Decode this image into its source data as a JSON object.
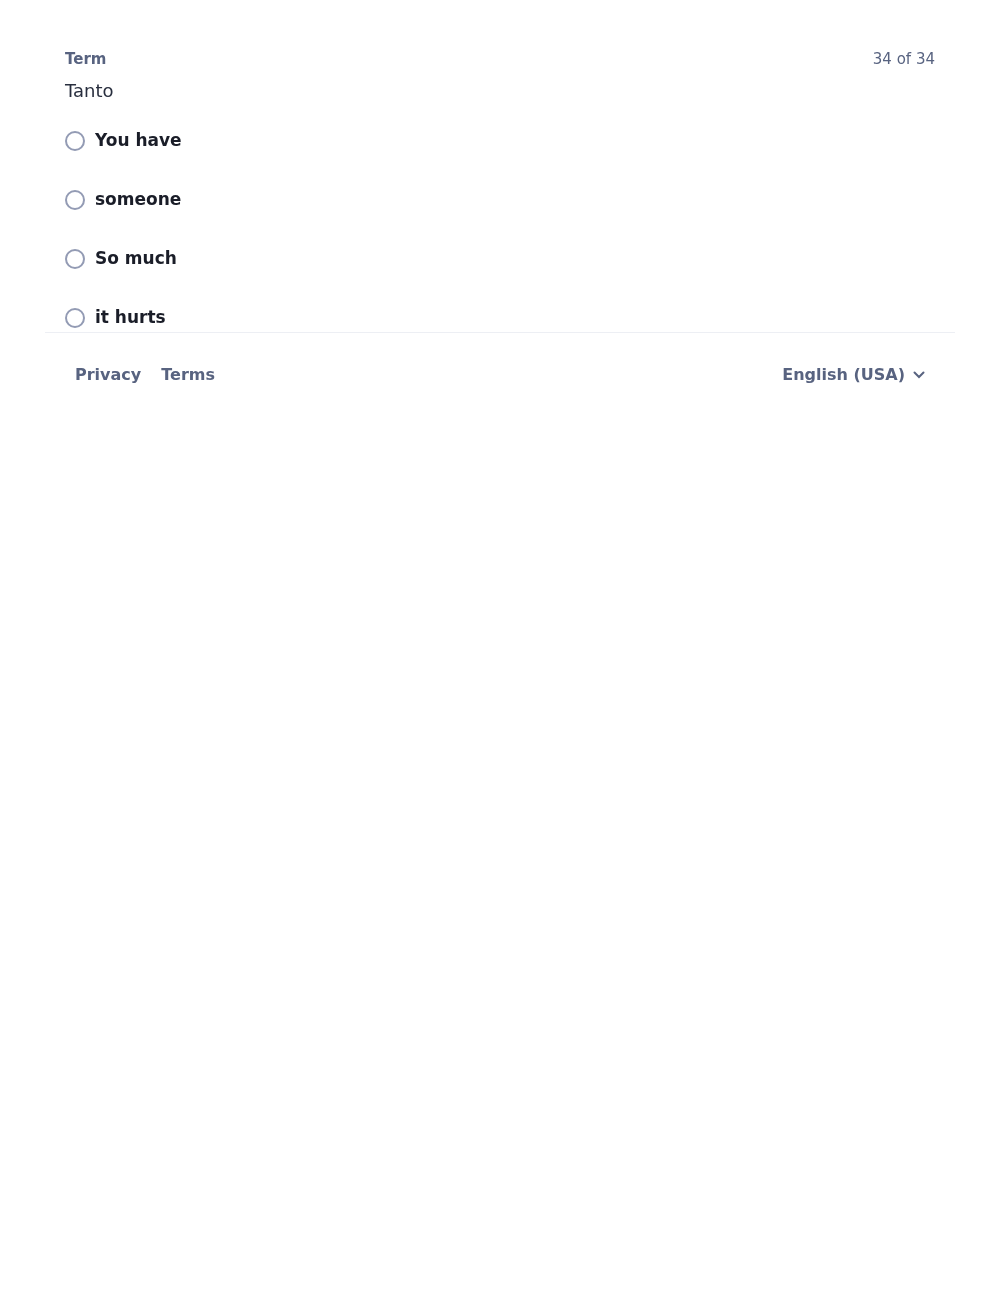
{
  "card": {
    "label": "Term",
    "counter": "34 of 34",
    "term": "Tanto",
    "options": [
      {
        "text": "You have",
        "selected": false
      },
      {
        "text": "someone",
        "selected": false
      },
      {
        "text": "So much",
        "selected": false
      },
      {
        "text": "it hurts",
        "selected": false
      }
    ]
  },
  "footer": {
    "links": [
      "Privacy",
      "Terms"
    ],
    "language": "English (USA)"
  }
}
